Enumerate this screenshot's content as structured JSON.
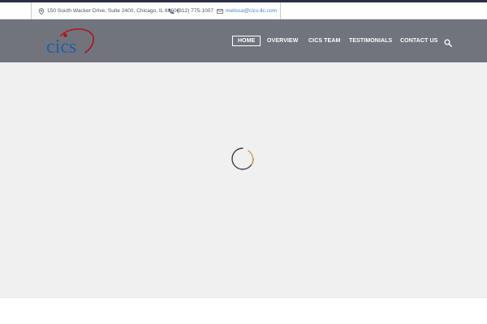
{
  "topbar": {
    "address": "150 South Wacker Drive, Suite 2400, Chicago, IL 60606",
    "phone": "(312) 775-1007",
    "email": "melissa@cics-llc.com",
    "address_icon": "map-pin-icon",
    "phone_icon": "phone-icon",
    "email_icon": "envelope-icon"
  },
  "header": {
    "logo_text": "cics",
    "nav": [
      {
        "label": "HOME",
        "active": true
      },
      {
        "label": "OVERVIEW",
        "active": false
      },
      {
        "label": "CICS TEAM",
        "active": false
      },
      {
        "label": "TESTIMONIALS",
        "active": false
      },
      {
        "label": "CONTACT US",
        "active": false
      }
    ],
    "search_icon": "search-icon"
  },
  "main": {
    "loading_indicator": "spinner-icon"
  },
  "colors": {
    "accent_strip": "#2c2f44",
    "header_bg": "#71747d",
    "main_bg": "#f0f0f1",
    "logo_blue": "#1f5fa8",
    "logo_red": "#b3121a",
    "link_blue": "#4b86c5",
    "spinner_gold": "#d3a15a",
    "spinner_dark": "#3b3f4a"
  }
}
